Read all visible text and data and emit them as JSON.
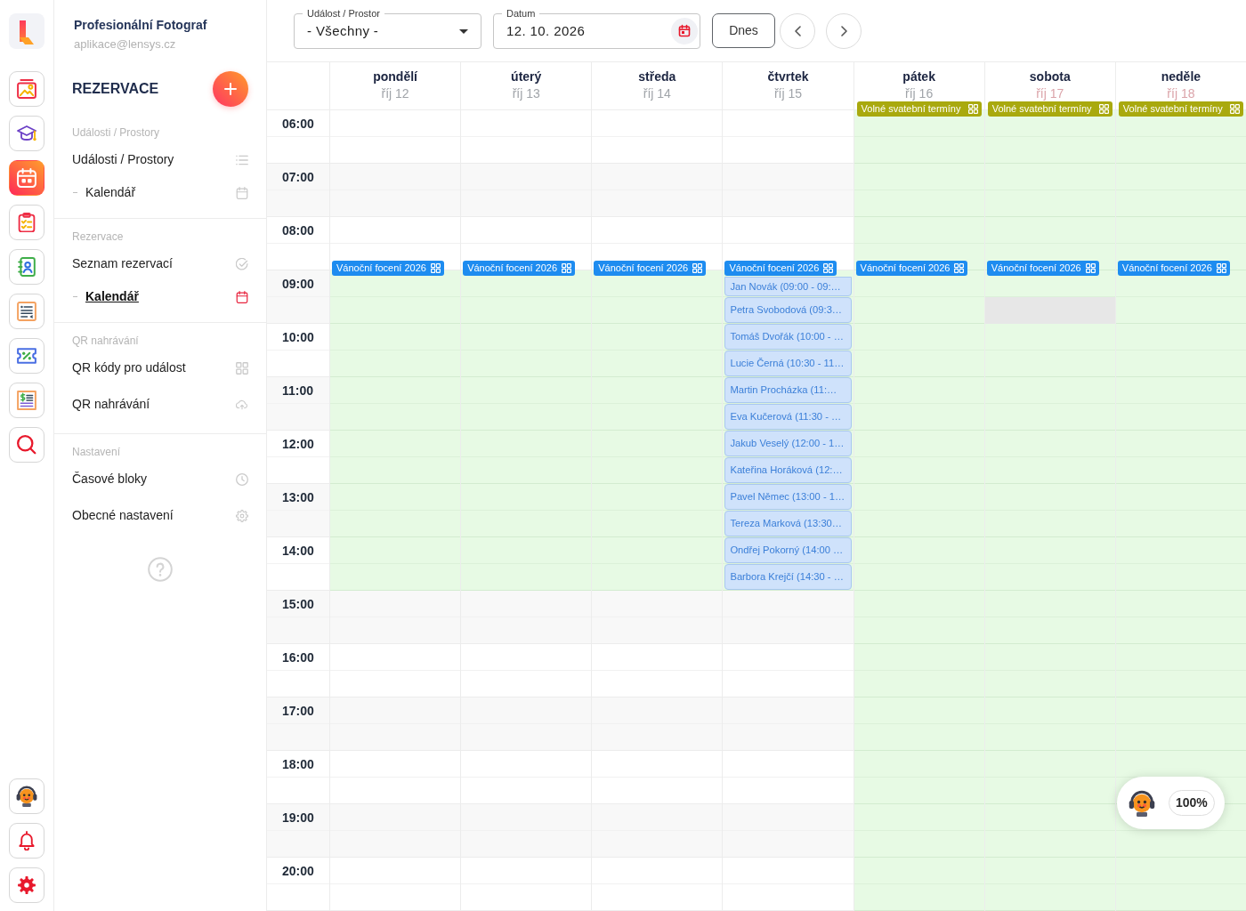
{
  "rail": {
    "items": [
      {
        "selected": false
      },
      {
        "selected": false
      },
      {
        "selected": true
      },
      {
        "selected": false
      },
      {
        "selected": false
      },
      {
        "selected": false
      },
      {
        "selected": false
      },
      {
        "selected": false
      },
      {
        "selected": false
      }
    ]
  },
  "account": {
    "name": "Profesionální Fotograf",
    "email": "aplikace@lensys.cz"
  },
  "sidebar": {
    "title": "REZERVACE",
    "sections": [
      {
        "label": "Události / Prostory",
        "items": [
          {
            "label": "Události / Prostory",
            "selected": false,
            "children": [
              {
                "label": "Kalendář",
                "selected": false
              }
            ]
          }
        ]
      },
      {
        "label": "Rezervace",
        "items": [
          {
            "label": "Seznam rezervací",
            "selected": false,
            "children": [
              {
                "label": "Kalendář",
                "selected": true
              }
            ]
          }
        ]
      },
      {
        "label": "QR nahrávání",
        "items": [
          {
            "label": "QR kódy pro událost",
            "selected": false
          },
          {
            "label": "QR nahrávání",
            "selected": false
          }
        ]
      },
      {
        "label": "Nastavení",
        "items": [
          {
            "label": "Časové bloky",
            "selected": false
          },
          {
            "label": "Obecné nastavení",
            "selected": false
          }
        ]
      }
    ]
  },
  "toolbar": {
    "event_filter": {
      "label": "Událost / Prostor",
      "value": "- Všechny -"
    },
    "date_filter": {
      "label": "Datum",
      "value": "12. 10. 2026"
    },
    "today_button": "Dnes"
  },
  "calendar": {
    "hours": [
      "06:00",
      "07:00",
      "08:00",
      "09:00",
      "10:00",
      "11:00",
      "12:00",
      "13:00",
      "14:00",
      "15:00",
      "16:00",
      "17:00",
      "18:00",
      "19:00",
      "20:00"
    ],
    "days": [
      {
        "name": "pondělí",
        "date": "říj 12",
        "weekend": false,
        "slots": [
          {
            "kind": "closed"
          },
          {
            "kind": "closed"
          },
          {
            "kind": "closed"
          },
          {
            "kind": "closed"
          },
          {
            "kind": "closed"
          },
          {
            "kind": "closed"
          },
          {
            "kind": "open",
            "event": {
              "title": "Vánoční focení 2026",
              "color": "#1e8cf0"
            }
          },
          {
            "kind": "open"
          },
          {
            "kind": "open"
          },
          {
            "kind": "open"
          },
          {
            "kind": "open"
          },
          {
            "kind": "open"
          },
          {
            "kind": "open"
          },
          {
            "kind": "open"
          },
          {
            "kind": "open"
          },
          {
            "kind": "open"
          },
          {
            "kind": "open"
          },
          {
            "kind": "open"
          },
          {
            "kind": "closed"
          },
          {
            "kind": "closed"
          },
          {
            "kind": "closed"
          },
          {
            "kind": "closed"
          },
          {
            "kind": "closed"
          },
          {
            "kind": "closed"
          },
          {
            "kind": "closed"
          },
          {
            "kind": "closed"
          },
          {
            "kind": "closed"
          },
          {
            "kind": "closed"
          },
          {
            "kind": "closed"
          },
          {
            "kind": "closed"
          }
        ]
      },
      {
        "name": "úterý",
        "date": "říj 13",
        "weekend": false,
        "slots": [
          {
            "kind": "closed"
          },
          {
            "kind": "closed"
          },
          {
            "kind": "closed"
          },
          {
            "kind": "closed"
          },
          {
            "kind": "closed"
          },
          {
            "kind": "closed"
          },
          {
            "kind": "open",
            "event": {
              "title": "Vánoční focení 2026",
              "color": "#1e8cf0"
            }
          },
          {
            "kind": "open"
          },
          {
            "kind": "open"
          },
          {
            "kind": "open"
          },
          {
            "kind": "open"
          },
          {
            "kind": "open"
          },
          {
            "kind": "open"
          },
          {
            "kind": "open"
          },
          {
            "kind": "open"
          },
          {
            "kind": "open"
          },
          {
            "kind": "open"
          },
          {
            "kind": "open"
          },
          {
            "kind": "closed"
          },
          {
            "kind": "closed"
          },
          {
            "kind": "closed"
          },
          {
            "kind": "closed"
          },
          {
            "kind": "closed"
          },
          {
            "kind": "closed"
          },
          {
            "kind": "closed"
          },
          {
            "kind": "closed"
          },
          {
            "kind": "closed"
          },
          {
            "kind": "closed"
          },
          {
            "kind": "closed"
          },
          {
            "kind": "closed"
          }
        ]
      },
      {
        "name": "středa",
        "date": "říj 14",
        "weekend": false,
        "slots": [
          {
            "kind": "closed"
          },
          {
            "kind": "closed"
          },
          {
            "kind": "closed"
          },
          {
            "kind": "closed"
          },
          {
            "kind": "closed"
          },
          {
            "kind": "closed"
          },
          {
            "kind": "open",
            "event": {
              "title": "Vánoční focení 2026",
              "color": "#1e8cf0"
            }
          },
          {
            "kind": "open"
          },
          {
            "kind": "open"
          },
          {
            "kind": "open"
          },
          {
            "kind": "open"
          },
          {
            "kind": "open"
          },
          {
            "kind": "open"
          },
          {
            "kind": "open"
          },
          {
            "kind": "open"
          },
          {
            "kind": "open"
          },
          {
            "kind": "open"
          },
          {
            "kind": "open"
          },
          {
            "kind": "closed"
          },
          {
            "kind": "closed"
          },
          {
            "kind": "closed"
          },
          {
            "kind": "closed"
          },
          {
            "kind": "closed"
          },
          {
            "kind": "closed"
          },
          {
            "kind": "closed"
          },
          {
            "kind": "closed"
          },
          {
            "kind": "closed"
          },
          {
            "kind": "closed"
          },
          {
            "kind": "closed"
          },
          {
            "kind": "closed"
          }
        ]
      },
      {
        "name": "čtvrtek",
        "date": "říj 15",
        "weekend": false,
        "slots": [
          {
            "kind": "closed"
          },
          {
            "kind": "closed"
          },
          {
            "kind": "closed"
          },
          {
            "kind": "closed"
          },
          {
            "kind": "closed"
          },
          {
            "kind": "closed"
          },
          {
            "kind": "open",
            "event": {
              "title": "Vánoční focení 2026",
              "color": "#1e8cf0"
            },
            "booking": "Jan Novák (09:00 - 09:…"
          },
          {
            "kind": "open",
            "booking": "Petra Svobodová (09:3…"
          },
          {
            "kind": "open",
            "booking": "Tomáš Dvořák (10:00 - …"
          },
          {
            "kind": "open",
            "booking": "Lucie Černá (10:30 - 11…"
          },
          {
            "kind": "open",
            "booking": "Martin Procházka (11:…"
          },
          {
            "kind": "open",
            "booking": "Eva Kučerová (11:30 - …"
          },
          {
            "kind": "open",
            "booking": "Jakub Veselý (12:00 - 1…"
          },
          {
            "kind": "open",
            "booking": "Kateřina Horáková (12:…"
          },
          {
            "kind": "open",
            "booking": "Pavel Němec (13:00 - 1…"
          },
          {
            "kind": "open",
            "booking": "Tereza Marková (13:30…"
          },
          {
            "kind": "open",
            "booking": "Ondřej Pokorný (14:00 …"
          },
          {
            "kind": "open",
            "booking": "Barbora Krejčí (14:30 - …"
          },
          {
            "kind": "closed"
          },
          {
            "kind": "closed"
          },
          {
            "kind": "closed"
          },
          {
            "kind": "closed"
          },
          {
            "kind": "closed"
          },
          {
            "kind": "closed"
          },
          {
            "kind": "closed"
          },
          {
            "kind": "closed"
          },
          {
            "kind": "closed"
          },
          {
            "kind": "closed"
          },
          {
            "kind": "closed"
          },
          {
            "kind": "closed"
          }
        ]
      },
      {
        "name": "pátek",
        "date": "říj 16",
        "weekend": false,
        "all_day": [
          {
            "title": "Volné svatební termíny",
            "color": "#a9a90e"
          }
        ],
        "slots": [
          {
            "kind": "open"
          },
          {
            "kind": "open"
          },
          {
            "kind": "open"
          },
          {
            "kind": "open"
          },
          {
            "kind": "open"
          },
          {
            "kind": "open"
          },
          {
            "kind": "open",
            "event": {
              "title": "Vánoční focení 2026",
              "color": "#1e8cf0"
            }
          },
          {
            "kind": "open"
          },
          {
            "kind": "open"
          },
          {
            "kind": "open"
          },
          {
            "kind": "open"
          },
          {
            "kind": "open"
          },
          {
            "kind": "open"
          },
          {
            "kind": "open"
          },
          {
            "kind": "open"
          },
          {
            "kind": "open"
          },
          {
            "kind": "open"
          },
          {
            "kind": "open"
          },
          {
            "kind": "open"
          },
          {
            "kind": "open"
          },
          {
            "kind": "open"
          },
          {
            "kind": "open"
          },
          {
            "kind": "open"
          },
          {
            "kind": "open"
          },
          {
            "kind": "open"
          },
          {
            "kind": "open"
          },
          {
            "kind": "open"
          },
          {
            "kind": "open"
          },
          {
            "kind": "open"
          },
          {
            "kind": "open"
          }
        ]
      },
      {
        "name": "sobota",
        "date": "říj 17",
        "weekend": true,
        "all_day": [
          {
            "title": "Volné svatební termíny",
            "color": "#a9a90e"
          }
        ],
        "slots": [
          {
            "kind": "open"
          },
          {
            "kind": "open"
          },
          {
            "kind": "open"
          },
          {
            "kind": "open"
          },
          {
            "kind": "open"
          },
          {
            "kind": "open"
          },
          {
            "kind": "open",
            "event": {
              "title": "Vánoční focení 2026",
              "color": "#1e8cf0"
            }
          },
          {
            "kind": "blocked"
          },
          {
            "kind": "open"
          },
          {
            "kind": "open"
          },
          {
            "kind": "open"
          },
          {
            "kind": "open"
          },
          {
            "kind": "open"
          },
          {
            "kind": "open"
          },
          {
            "kind": "open"
          },
          {
            "kind": "open"
          },
          {
            "kind": "open"
          },
          {
            "kind": "open"
          },
          {
            "kind": "open"
          },
          {
            "kind": "open"
          },
          {
            "kind": "open"
          },
          {
            "kind": "open"
          },
          {
            "kind": "open"
          },
          {
            "kind": "open"
          },
          {
            "kind": "open"
          },
          {
            "kind": "open"
          },
          {
            "kind": "open"
          },
          {
            "kind": "open"
          },
          {
            "kind": "open"
          },
          {
            "kind": "open"
          }
        ]
      },
      {
        "name": "neděle",
        "date": "říj 18",
        "weekend": true,
        "all_day": [
          {
            "title": "Volné svatební termíny",
            "color": "#a9a90e"
          }
        ],
        "slots": [
          {
            "kind": "open"
          },
          {
            "kind": "open"
          },
          {
            "kind": "open"
          },
          {
            "kind": "open"
          },
          {
            "kind": "open"
          },
          {
            "kind": "open"
          },
          {
            "kind": "open",
            "event": {
              "title": "Vánoční focení 2026",
              "color": "#1e8cf0"
            }
          },
          {
            "kind": "open"
          },
          {
            "kind": "open"
          },
          {
            "kind": "open"
          },
          {
            "kind": "open"
          },
          {
            "kind": "open"
          },
          {
            "kind": "open"
          },
          {
            "kind": "open"
          },
          {
            "kind": "open"
          },
          {
            "kind": "open"
          },
          {
            "kind": "open"
          },
          {
            "kind": "open"
          },
          {
            "kind": "open"
          },
          {
            "kind": "open"
          },
          {
            "kind": "open"
          },
          {
            "kind": "open"
          },
          {
            "kind": "open"
          },
          {
            "kind": "open"
          },
          {
            "kind": "open"
          },
          {
            "kind": "open"
          },
          {
            "kind": "open"
          },
          {
            "kind": "open"
          },
          {
            "kind": "open"
          },
          {
            "kind": "open"
          }
        ]
      }
    ]
  },
  "assistant": {
    "zoom": "100%"
  }
}
